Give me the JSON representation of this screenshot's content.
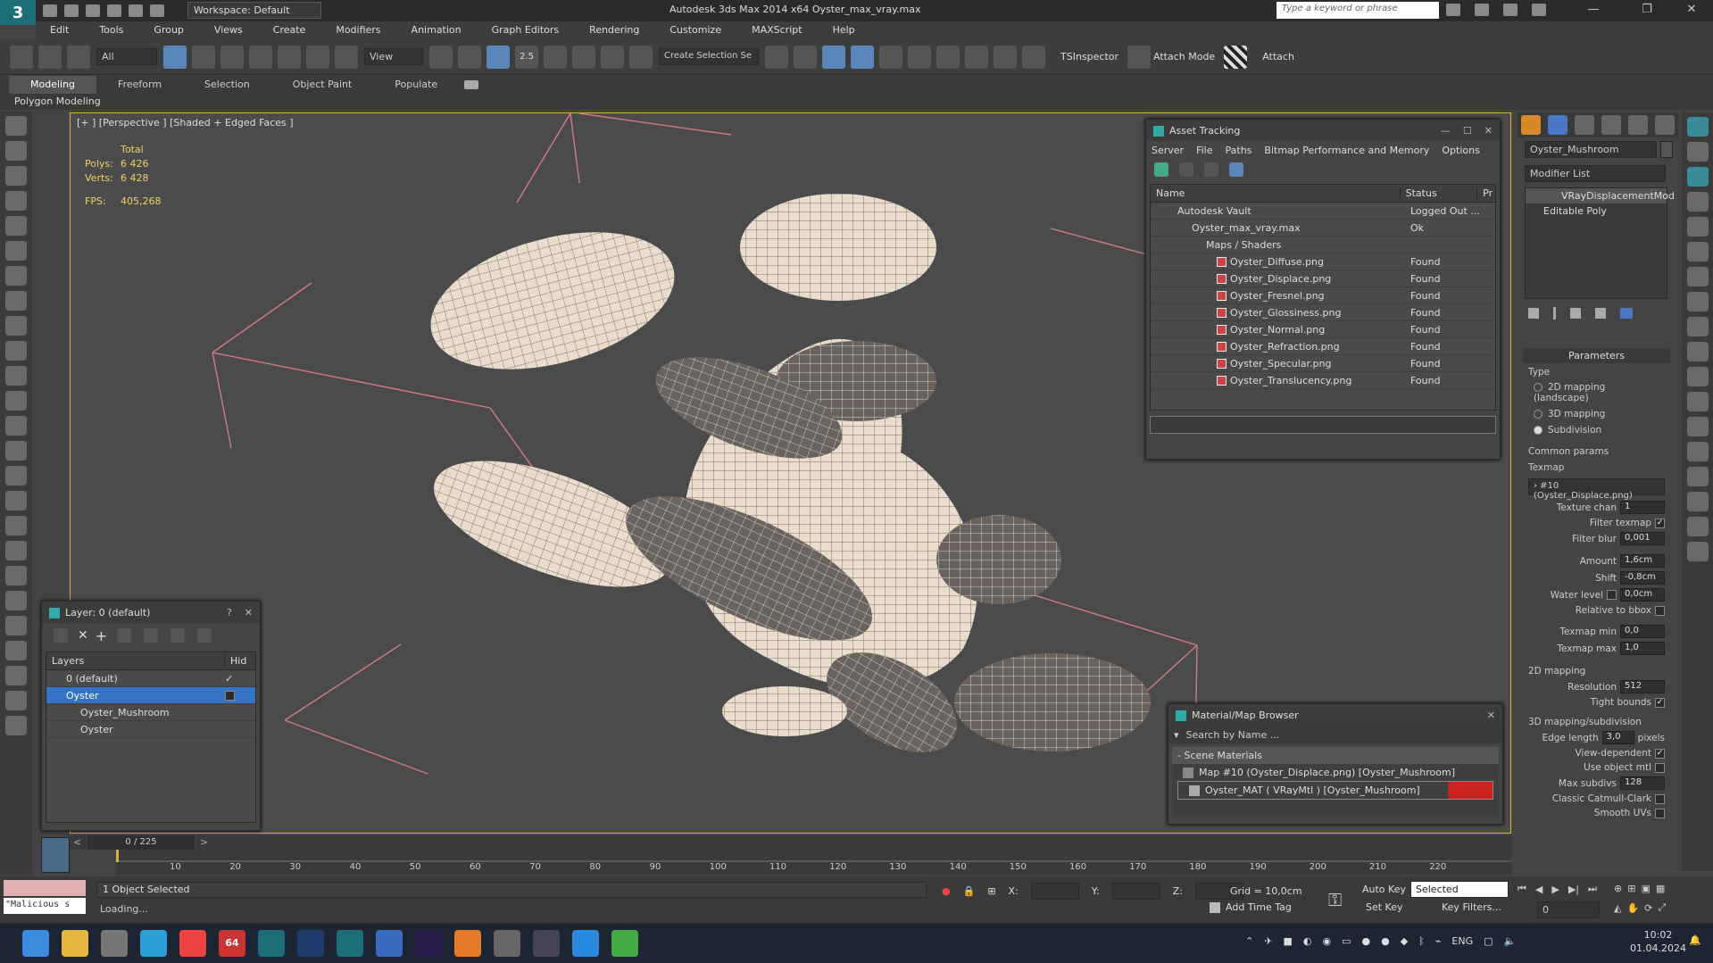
{
  "titlebar": {
    "workspace": "Workspace: Default",
    "title": "Autodesk 3ds Max  2014 x64     Oyster_max_vray.max",
    "search_placeholder": "Type a keyword or phrase"
  },
  "menu": [
    "Edit",
    "Tools",
    "Group",
    "Views",
    "Create",
    "Modifiers",
    "Animation",
    "Graph Editors",
    "Rendering",
    "Customize",
    "MAXScript",
    "Help"
  ],
  "toolbar": {
    "filter": "All",
    "ref_coord": "View",
    "snap_value": "2.5",
    "selection_set": "Create Selection Se",
    "ts_inspector": "TSInspector",
    "attach_mode": "Attach Mode",
    "attach": "Attach"
  },
  "ribbon": {
    "tabs": [
      "Modeling",
      "Freeform",
      "Selection",
      "Object Paint",
      "Populate"
    ],
    "sub": "Polygon Modeling"
  },
  "viewport": {
    "label": "[+ ] [Perspective ] [Shaded + Edged Faces ]",
    "stats": {
      "total": "Total",
      "polys_label": "Polys:",
      "polys": "6 426",
      "verts_label": "Verts:",
      "verts": "6 428",
      "fps_label": "FPS:",
      "fps": "405,268"
    }
  },
  "asset_tracking": {
    "title": "Asset Tracking",
    "menu": [
      "Server",
      "File",
      "Paths",
      "Bitmap Performance and Memory",
      "Options"
    ],
    "columns": [
      "Name",
      "Status",
      "Pr"
    ],
    "rows": [
      {
        "name": "Autodesk Vault",
        "status": "Logged Out ..."
      },
      {
        "name": "Oyster_max_vray.max",
        "status": "Ok"
      },
      {
        "name": "Maps / Shaders",
        "status": ""
      },
      {
        "name": "Oyster_Diffuse.png",
        "status": "Found"
      },
      {
        "name": "Oyster_Displace.png",
        "status": "Found"
      },
      {
        "name": "Oyster_Fresnel.png",
        "status": "Found"
      },
      {
        "name": "Oyster_Glossiness.png",
        "status": "Found"
      },
      {
        "name": "Oyster_Normal.png",
        "status": "Found"
      },
      {
        "name": "Oyster_Refraction.png",
        "status": "Found"
      },
      {
        "name": "Oyster_Specular.png",
        "status": "Found"
      },
      {
        "name": "Oyster_Translucency.png",
        "status": "Found"
      }
    ]
  },
  "layer_panel": {
    "title": "Layer: 0 (default)",
    "help": "?",
    "col_layers": "Layers",
    "col_hide": "Hid",
    "rows": [
      {
        "name": "0 (default)"
      },
      {
        "name": "Oyster"
      },
      {
        "name": "Oyster_Mushroom"
      },
      {
        "name": "Oyster"
      }
    ]
  },
  "material_browser": {
    "title": "Material/Map Browser",
    "search_placeholder": "Search by Name ...",
    "section": "- Scene Materials",
    "items": [
      {
        "name": "Map #10 (Oyster_Displace.png) [Oyster_Mushroom]"
      },
      {
        "name": "Oyster_MAT  ( VRayMtl )  [Oyster_Mushroom]"
      }
    ]
  },
  "command_panel": {
    "object_name": "Oyster_Mushroom",
    "modifier_list": "Modifier List",
    "stack": [
      "VRayDisplacementMod",
      "Editable Poly"
    ],
    "parameters": "Parameters",
    "type_label": "Type",
    "type_options": [
      "2D mapping (landscape)",
      "3D mapping",
      "Subdivision"
    ],
    "common_params": "Common params",
    "texmap_label": "Texmap",
    "texmap": "› #10 (Oyster_Displace.png)",
    "params": [
      {
        "label": "Texture chan",
        "value": "1"
      },
      {
        "label": "Filter texmap",
        "value": "✓"
      },
      {
        "label": "Filter blur",
        "value": "0,001"
      },
      {
        "label": "Amount",
        "value": "1,6cm"
      },
      {
        "label": "Shift",
        "value": "-0,8cm"
      },
      {
        "label": "Water level",
        "value": "0,0cm"
      },
      {
        "label": "Relative to bbox",
        "value": ""
      },
      {
        "label": "Texmap min",
        "value": "0,0"
      },
      {
        "label": "Texmap max",
        "value": "1,0"
      }
    ],
    "mapping2d": "2D mapping",
    "resolution_label": "Resolution",
    "resolution": "512",
    "tight_bounds": "Tight bounds",
    "mapping3d": "3D mapping/subdivision",
    "edge_length_label": "Edge length",
    "edge_length": "3,0",
    "pixels": "pixels",
    "view_dependent": "View-dependent",
    "use_object_mtl": "Use object mtl",
    "max_subdivs_label": "Max subdivs",
    "max_subdivs": "128",
    "classic_cc": "Classic Catmull-Clark",
    "smooth_uvs": "Smooth UVs"
  },
  "timeline": {
    "frame": "0 / 225",
    "ticks": [
      "10",
      "20",
      "30",
      "40",
      "50",
      "60",
      "70",
      "80",
      "90",
      "100",
      "110",
      "120",
      "130",
      "140",
      "150",
      "160",
      "170",
      "180",
      "190",
      "200",
      "210",
      "220"
    ]
  },
  "status": {
    "maxscript": "\"Malicious s",
    "selected": "1 Object Selected",
    "loading": "Loading...",
    "x": "X:",
    "y": "Y:",
    "z": "Z:",
    "grid": "Grid = 10,0cm",
    "auto_key": "Auto Key",
    "set_key": "Set Key",
    "selected_dropdown": "Selected",
    "key_filters": "Key Filters...",
    "add_time_tag": "Add Time Tag",
    "frame_field": "0"
  },
  "taskbar": {
    "lang": "ENG",
    "time": "10:02",
    "date": "01.04.2024",
    "badge": "64"
  }
}
